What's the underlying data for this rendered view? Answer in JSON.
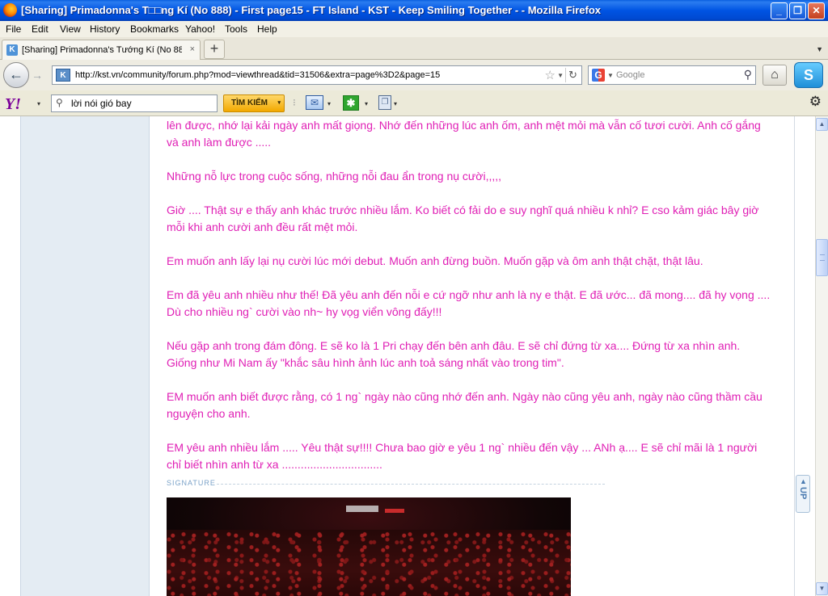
{
  "window": {
    "title": "[Sharing] Primadonna's T□□ng Kí (No 888) - First page15 - FT Island - KST - Keep Smiling Together - - Mozilla Firefox",
    "minimize_glyph": "_",
    "maximize_glyph": "❐",
    "close_glyph": "✕"
  },
  "menu": [
    "File",
    "Edit",
    "View",
    "History",
    "Bookmarks",
    "Yahoo!",
    "Tools",
    "Help"
  ],
  "tabs": [
    {
      "label": "[Sharing] Primadonna's Tướng Kí (No 888) - ...",
      "favicon": "kst-favicon",
      "close": "×"
    }
  ],
  "tabbar": {
    "newtab_glyph": "+",
    "list_glyph": "▼"
  },
  "nav": {
    "back_glyph": "←",
    "forward_glyph": "→",
    "url": "http://kst.vn/community/forum.php?mod=viewthread&tid=31506&extra=page%3D2&page=15",
    "star_glyph": "☆",
    "reload_glyph": "↻",
    "search_engine": "G",
    "search_placeholder": "Google",
    "search_glyph": "⚲",
    "home_glyph": "⌂",
    "skype_glyph": "S"
  },
  "yahoo": {
    "logo": "Y!",
    "search_value": "lời nói gió bay",
    "search_button": "TÌM KIẾM",
    "mail_glyph": "✉",
    "gear_glyph": "⚙",
    "separator": "⁝",
    "arrow": "▾",
    "green_glyph": "✱",
    "doc_glyph": "❐",
    "search_glyph": "⚲"
  },
  "post": {
    "paragraphs": [
      "lên được, nhớ lại kải ngày anh mất giọng. Nhớ đến những lúc anh ốm, anh mệt mỏi mà vẫn cố tươi cười. Anh cố gắng và anh làm được .....",
      "Những nỗ lực trong cuộc sống, những nỗi đau ẩn trong nụ cười,,,,,",
      "Giờ .... Thật sự e thấy anh khác trước nhiều lắm. Ko biết có fải do e suy nghĩ quá nhiều k nhỉ? E cso kảm giác bây giờ mỗi khi anh cười anh đều rất mệt mỏi.",
      "Em muốn anh lấy lại nụ cười lúc mới debut. Muốn anh đừng buồn. Muốn gặp và ôm anh thật chặt, thật lâu.",
      "Em đã yêu anh nhiều như thế! Đã yêu anh đến nỗi e cứ ngỡ như anh là ny e thật. E đã ước... đã mong.... đã hy vọng .... Dù cho nhiều ng` cười vào nh~ hy vọg viển vông đấy!!!",
      "Nếu gặp anh trong đám đông. E sẽ ko là 1 Pri chạy đến bên anh đâu. E sẽ chỉ đứng từ xa.... Đứng từ xa nhìn anh. Giống như Mi Nam ấy \"khắc sâu hình ảnh lúc anh toả sáng nhất vào trong tim\".",
      "EM muốn anh biết được rằng, có 1 ng` ngày nào cũng nhớ đến anh. Ngày nào cũng yêu anh, ngày nào cũng thầm cầu nguyện cho anh.",
      "EM yêu anh nhiều lắm ..... Yêu thật sự!!!! Chưa bao giờ e yêu 1 ng` nhiều đến vậy ... ANh ạ.... E sẽ chỉ mãi là 1 người chỉ biết nhìn anh từ xa ................................"
    ],
    "signature_label": "SIGNATURE",
    "up_label": "UP",
    "up_glyph": "▲",
    "text_color": "#e01fb5"
  },
  "scrollbar": {
    "up_glyph": "▲",
    "down_glyph": "▼"
  }
}
